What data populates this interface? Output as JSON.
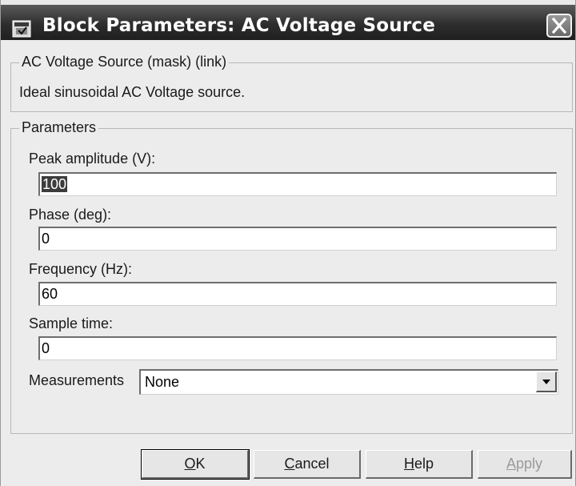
{
  "window": {
    "title": "Block Parameters: AC Voltage Source"
  },
  "mask_group": {
    "title": "AC Voltage Source (mask) (link)",
    "description": "Ideal sinusoidal AC Voltage source."
  },
  "params_group": {
    "title": "Parameters",
    "peak_amplitude": {
      "label": "Peak amplitude (V):",
      "value": "100"
    },
    "phase": {
      "label": "Phase (deg):",
      "value": "0"
    },
    "frequency": {
      "label": "Frequency (Hz):",
      "value": "60"
    },
    "sample_time": {
      "label": "Sample time:",
      "value": "0"
    },
    "measurements": {
      "label": "Measurements",
      "value": "None"
    }
  },
  "buttons": {
    "ok": {
      "mnemonic": "O",
      "rest": "K"
    },
    "cancel": {
      "mnemonic": "C",
      "rest": "ancel"
    },
    "help": {
      "mnemonic": "H",
      "rest": "elp"
    },
    "apply": {
      "mnemonic": "A",
      "rest": "pply"
    }
  },
  "icons": {
    "window": "simulink-block-icon",
    "close": "close-icon",
    "dropdown": "chevron-down-icon"
  }
}
